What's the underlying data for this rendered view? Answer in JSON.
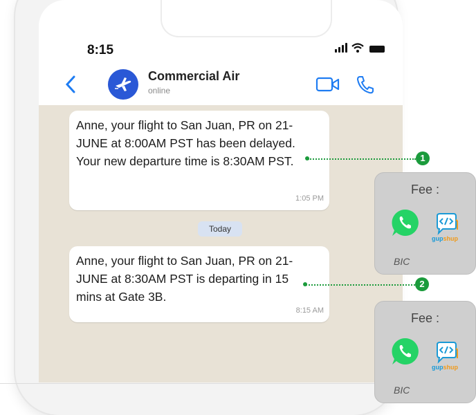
{
  "status_bar": {
    "time": "8:15"
  },
  "header": {
    "contact_name": "Commercial Air",
    "contact_status": "online"
  },
  "messages": [
    {
      "text": "Anne, your flight to San Juan, PR on 21-JUNE at 8:00AM PST has been delayed. Your new departure time is 8:30AM PST.",
      "time": "1:05 PM"
    },
    {
      "text": "Anne, your flight to San Juan, PR on 21-JUNE at 8:30AM PST is departing in 15 mins at Gate 3B.",
      "time": "8:15 AM"
    }
  ],
  "date_chip": "Today",
  "annotations": [
    {
      "number": "1",
      "fee_label": "Fee :",
      "tag": "BIC"
    },
    {
      "number": "2",
      "fee_label": "Fee :",
      "tag": "BIC"
    }
  ],
  "brand": {
    "gupshup_a": "gup",
    "gupshup_b": "shup"
  },
  "colors": {
    "accent_green": "#1b9b3c",
    "whatsapp_green": "#25d366",
    "avatar_blue": "#2a58d6",
    "ios_blue": "#1e7cf2"
  }
}
